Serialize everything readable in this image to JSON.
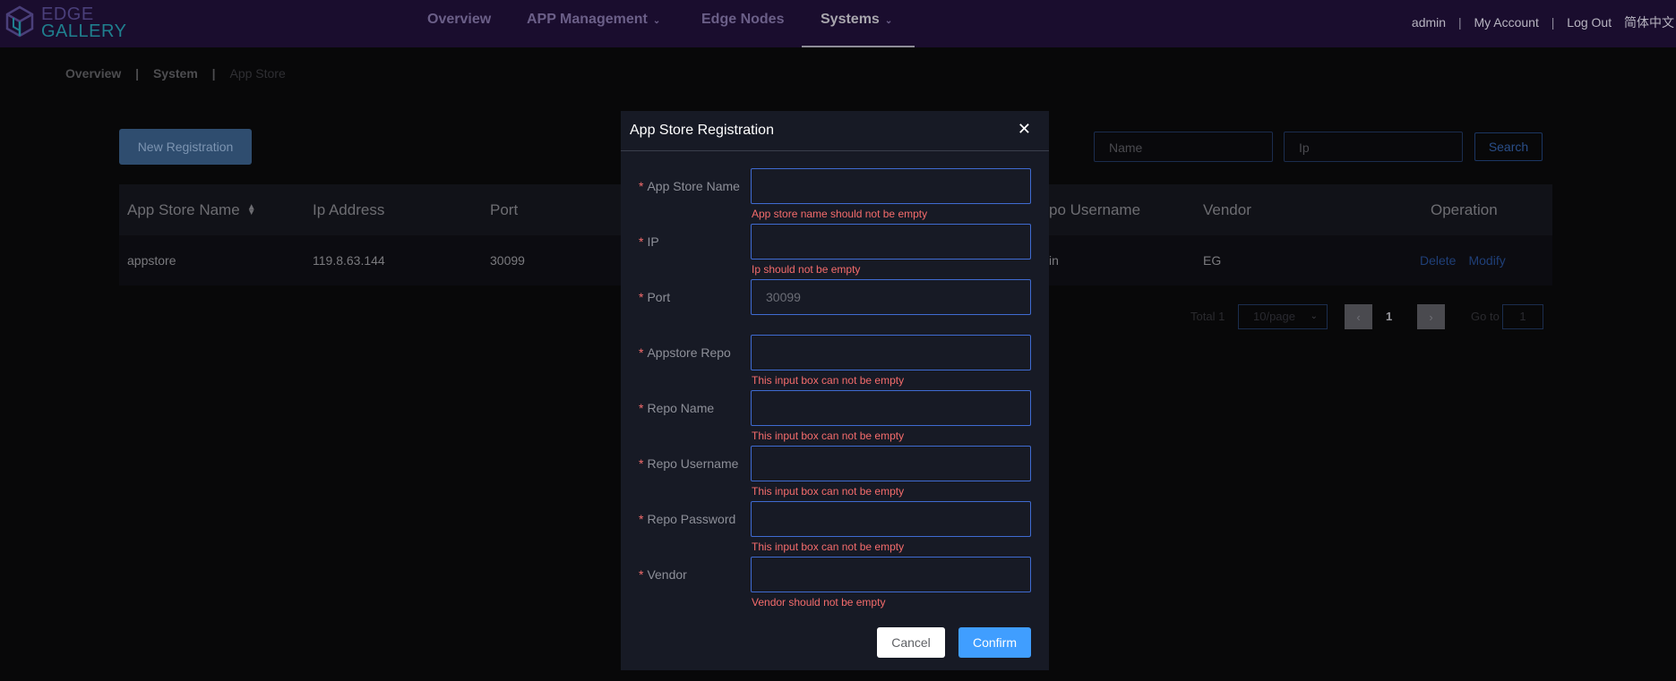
{
  "brand": {
    "line1": "EDGE",
    "line2": "GALLERY"
  },
  "nav": {
    "items": [
      {
        "label": "Overview",
        "chevron": false,
        "active": false
      },
      {
        "label": "APP Management",
        "chevron": true,
        "active": false
      },
      {
        "label": "Edge Nodes",
        "chevron": false,
        "active": false
      },
      {
        "label": "Systems",
        "chevron": true,
        "active": true
      }
    ]
  },
  "user": {
    "name": "admin",
    "my_account": "My Account",
    "logout": "Log Out",
    "language": "简体中文",
    "separator": "|"
  },
  "breadcrumb": {
    "items": [
      "Overview",
      "System",
      "App Store"
    ],
    "separator": "|"
  },
  "page": {
    "new_registration": "New Registration",
    "search_name_placeholder": "Name",
    "search_ip_placeholder": "Ip",
    "search_button": "Search"
  },
  "table": {
    "columns": [
      "App Store Name",
      "Ip Address",
      "Port",
      "po Username",
      "Vendor",
      "Operation"
    ],
    "rows": [
      {
        "name": "appstore",
        "ip": "119.8.63.144",
        "port": "30099",
        "username": "in",
        "vendor": "EG",
        "delete": "Delete",
        "modify": "Modify"
      }
    ]
  },
  "pagination": {
    "total": "Total 1",
    "page_size": "10/page",
    "current_page": "1",
    "goto_label": "Go to",
    "goto_value": "1"
  },
  "modal": {
    "title": "App Store Registration",
    "fields": [
      {
        "label": "App Store Name",
        "value": "",
        "placeholder": "",
        "error": "App store name should not be empty"
      },
      {
        "label": "IP",
        "value": "",
        "placeholder": "",
        "error": "Ip should not be empty"
      },
      {
        "label": "Port",
        "value": "",
        "placeholder": "30099",
        "error": ""
      },
      {
        "label": "Appstore Repo",
        "value": "",
        "placeholder": "",
        "error": "This input box can not be empty"
      },
      {
        "label": "Repo Name",
        "value": "",
        "placeholder": "",
        "error": "This input box can not be empty"
      },
      {
        "label": "Repo Username",
        "value": "",
        "placeholder": "",
        "error": "This input box can not be empty"
      },
      {
        "label": "Repo Password",
        "value": "",
        "placeholder": "",
        "error": "This input box can not be empty"
      },
      {
        "label": "Vendor",
        "value": "",
        "placeholder": "",
        "error": "Vendor should not be empty"
      }
    ],
    "required_marker": "*",
    "cancel": "Cancel",
    "confirm": "Confirm"
  },
  "icons": {
    "logo": "cube-logo-icon",
    "nav_chevron": "chevron-down-icon",
    "sort": "sort-icon",
    "close": "close-icon",
    "prev": "chevron-left-icon",
    "next": "chevron-right-icon"
  },
  "colors": {
    "topbar": "#1a0d2e",
    "accent": "#409eff",
    "error": "#f56c6c",
    "modal_bg": "#171a25"
  }
}
